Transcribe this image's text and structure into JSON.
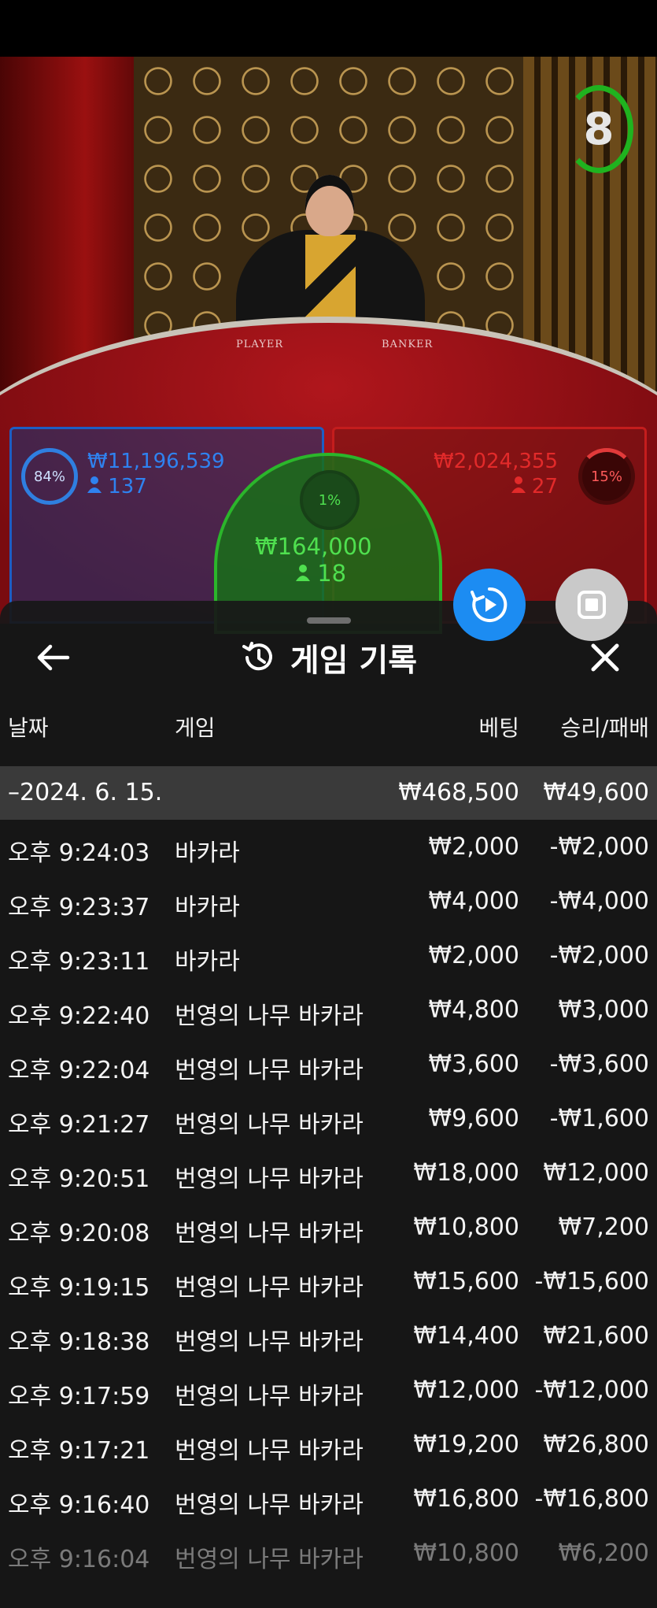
{
  "live": {
    "timer_value": "8",
    "table_labels": {
      "player": "PLAYER",
      "banker": "BANKER"
    },
    "player_side": {
      "percent": "84%",
      "amount": "₩11,196,539",
      "people": "137"
    },
    "tie_side": {
      "percent": "1%",
      "amount": "₩164,000",
      "people": "18"
    },
    "banker_side": {
      "percent": "15%",
      "amount": "₩2,024,355",
      "people": "27"
    }
  },
  "history": {
    "title": "게임 기록",
    "columns": {
      "date": "날짜",
      "game": "게임",
      "bet": "베팅",
      "result": "승리/패배"
    },
    "day": {
      "date": "–2024. 6. 15.",
      "bet_total": "₩468,500",
      "result_total": "₩49,600"
    },
    "rows": [
      {
        "time": "오후 9:24:03",
        "game": "바카라",
        "bet": "₩2,000",
        "result": "-₩2,000"
      },
      {
        "time": "오후 9:23:37",
        "game": "바카라",
        "bet": "₩4,000",
        "result": "-₩4,000"
      },
      {
        "time": "오후 9:23:11",
        "game": "바카라",
        "bet": "₩2,000",
        "result": "-₩2,000"
      },
      {
        "time": "오후 9:22:40",
        "game": "번영의 나무 바카라",
        "bet": "₩4,800",
        "result": "₩3,000"
      },
      {
        "time": "오후 9:22:04",
        "game": "번영의 나무 바카라",
        "bet": "₩3,600",
        "result": "-₩3,600"
      },
      {
        "time": "오후 9:21:27",
        "game": "번영의 나무 바카라",
        "bet": "₩9,600",
        "result": "-₩1,600"
      },
      {
        "time": "오후 9:20:51",
        "game": "번영의 나무 바카라",
        "bet": "₩18,000",
        "result": "₩12,000"
      },
      {
        "time": "오후 9:20:08",
        "game": "번영의 나무 바카라",
        "bet": "₩10,800",
        "result": "₩7,200"
      },
      {
        "time": "오후 9:19:15",
        "game": "번영의 나무 바카라",
        "bet": "₩15,600",
        "result": "-₩15,600"
      },
      {
        "time": "오후 9:18:38",
        "game": "번영의 나무 바카라",
        "bet": "₩14,400",
        "result": "₩21,600"
      },
      {
        "time": "오후 9:17:59",
        "game": "번영의 나무 바카라",
        "bet": "₩12,000",
        "result": "-₩12,000"
      },
      {
        "time": "오후 9:17:21",
        "game": "번영의 나무 바카라",
        "bet": "₩19,200",
        "result": "₩26,800"
      },
      {
        "time": "오후 9:16:40",
        "game": "번영의 나무 바카라",
        "bet": "₩16,800",
        "result": "-₩16,800"
      },
      {
        "time": "오후 9:16:04",
        "game": "번영의 나무 바카라",
        "bet": "₩10,800",
        "result": "₩6,200"
      }
    ]
  },
  "colors": {
    "player_blue": "#1d5ec4",
    "banker_red": "#c41d1d",
    "tie_green": "#2bb62b",
    "fab_blue": "#1c8cf2"
  },
  "icons": {
    "back": "arrow-left-icon",
    "history": "history-icon",
    "close": "close-icon",
    "replay": "replay-icon",
    "stop": "stop-icon"
  }
}
